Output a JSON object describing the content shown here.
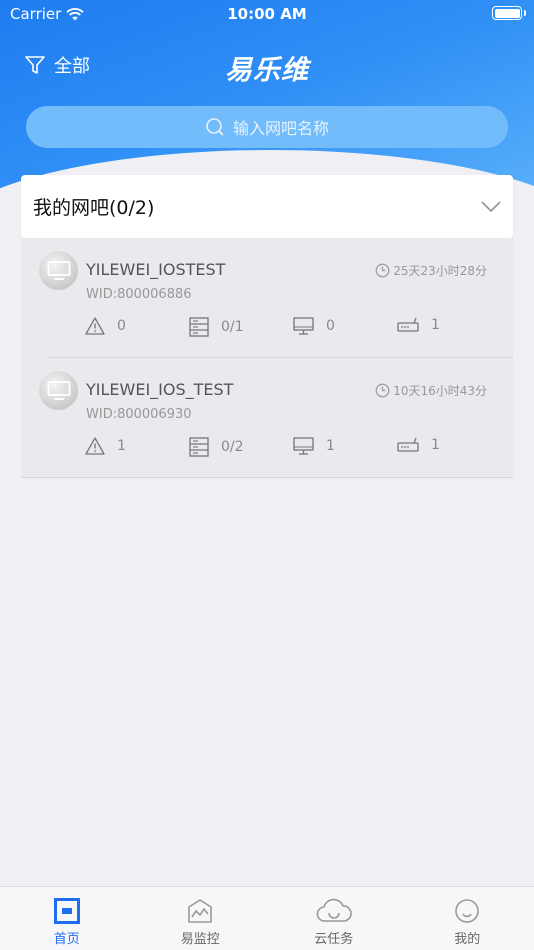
{
  "status_bar": {
    "carrier": "Carrier",
    "time": "10:00 AM"
  },
  "header": {
    "filter_label": "全部",
    "app_title": "易乐维"
  },
  "search": {
    "placeholder": "输入网吧名称"
  },
  "section": {
    "title": "我的网吧(0/2)"
  },
  "cafes": [
    {
      "name": "YILEWEI_IOSTEST",
      "wid": "WID:800006886",
      "uptime": "25天23小时28分",
      "alerts": "0",
      "servers": "0/1",
      "terminals": "0",
      "routers": "1"
    },
    {
      "name": "YILEWEI_IOS_TEST",
      "wid": "WID:800006930",
      "uptime": "10天16小时43分",
      "alerts": "1",
      "servers": "0/2",
      "terminals": "1",
      "routers": "1"
    }
  ],
  "tabbar": {
    "items": [
      {
        "label": "首页",
        "icon": "home-icon",
        "active": true
      },
      {
        "label": "易监控",
        "icon": "monitor-icon",
        "active": false
      },
      {
        "label": "云任务",
        "icon": "cloud-icon",
        "active": false
      },
      {
        "label": "我的",
        "icon": "profile-icon",
        "active": false
      }
    ]
  },
  "colors": {
    "accent": "#1e6ff0",
    "header_top": "#1e7cf0",
    "background": "#efeff4"
  }
}
